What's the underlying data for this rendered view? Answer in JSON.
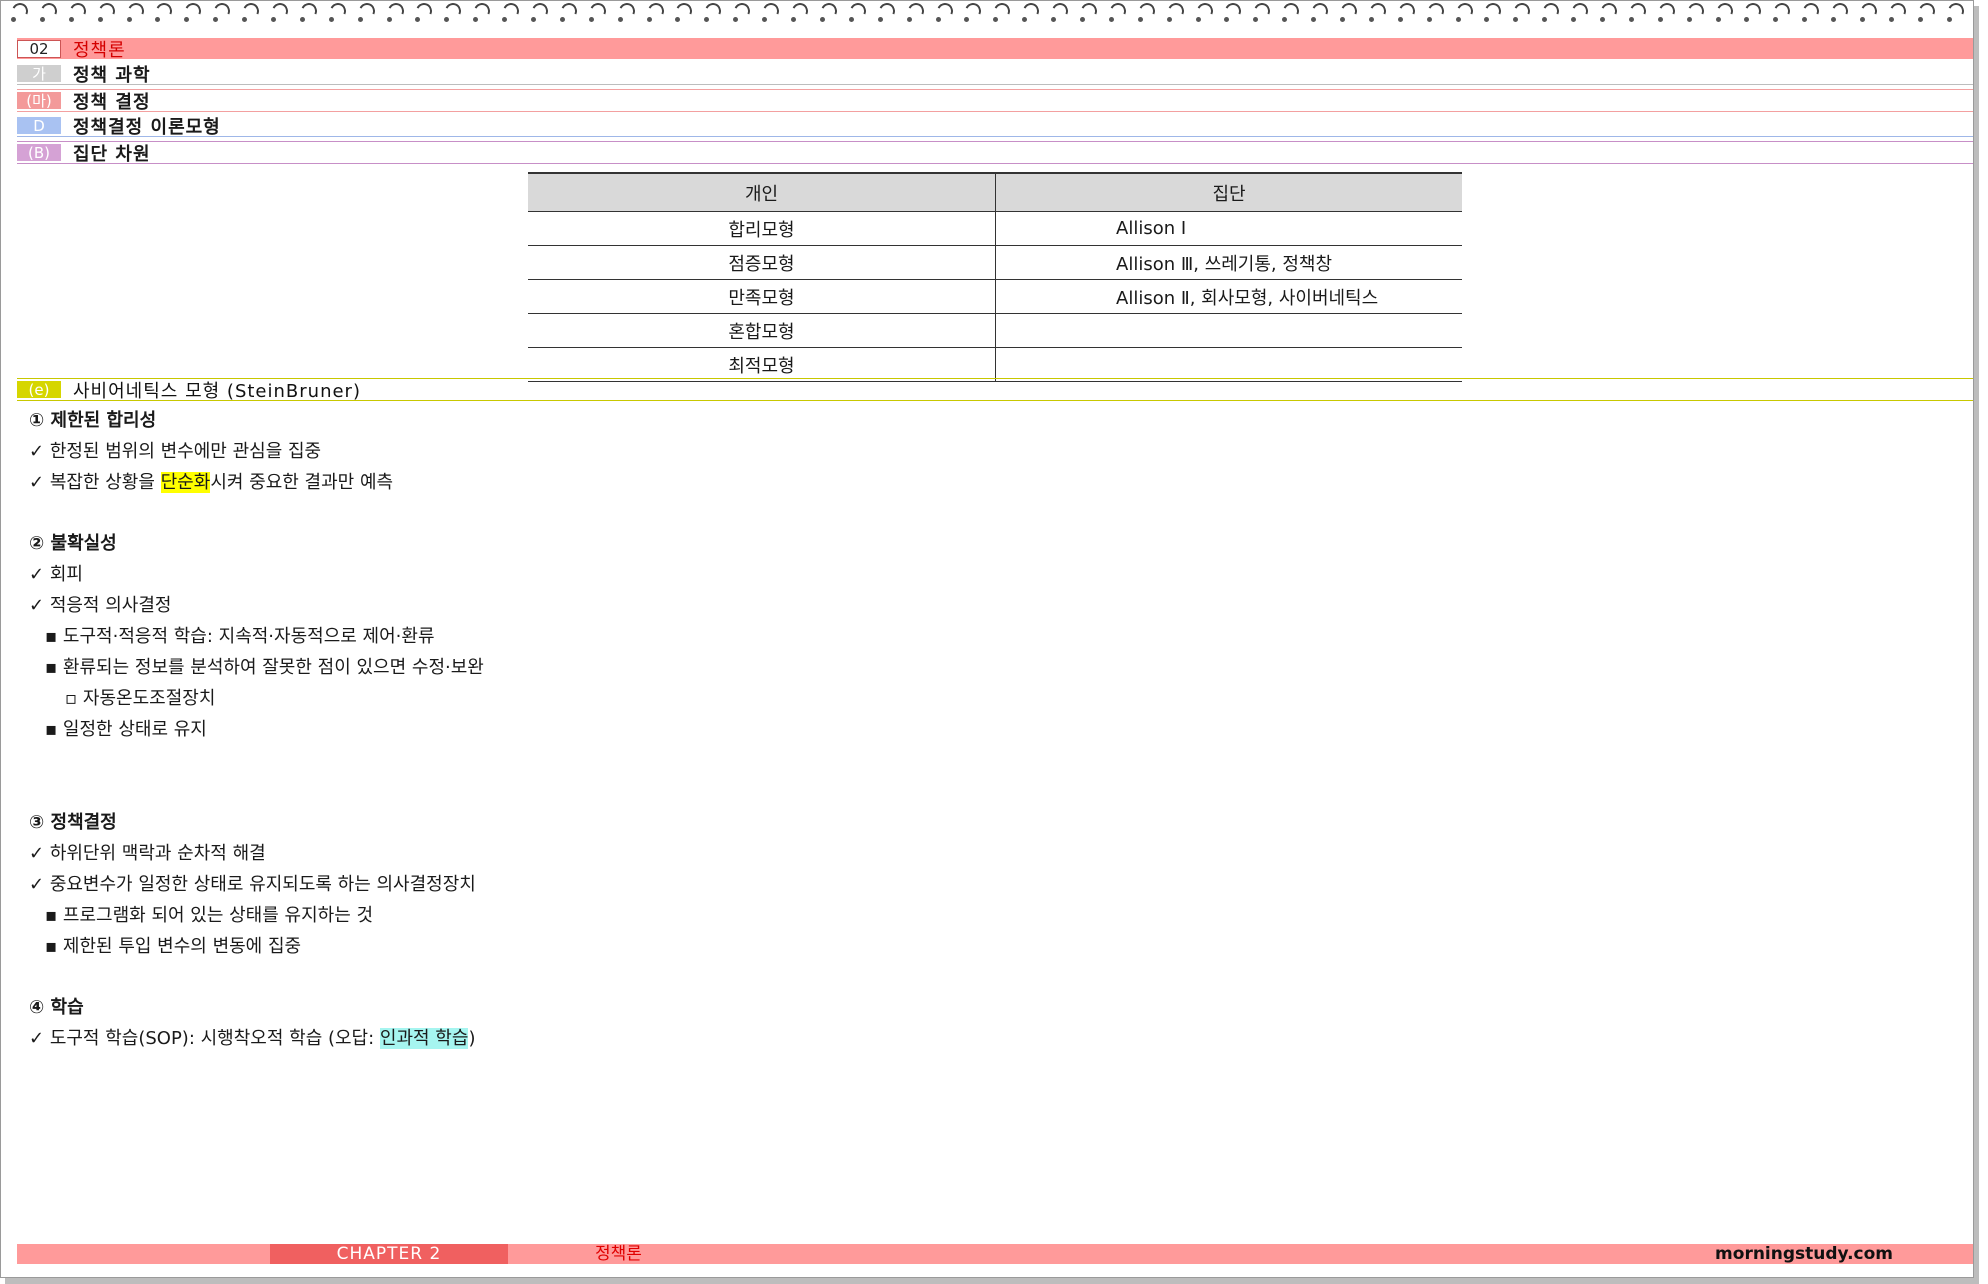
{
  "main_header": {
    "num": "02",
    "title": "정책론"
  },
  "sections": [
    {
      "tag": "가",
      "title": "정책 과학"
    },
    {
      "tag": "(마)",
      "title": "정책 결정"
    },
    {
      "tag": "D",
      "title": "정책결정 이론모형"
    },
    {
      "tag": "(B)",
      "title": "집단 차원"
    }
  ],
  "table": {
    "headers": [
      "개인",
      "집단"
    ],
    "rows": [
      [
        "합리모형",
        "Allison Ⅰ"
      ],
      [
        "점증모형",
        "Allison Ⅲ, 쓰레기통, 정책창"
      ],
      [
        "만족모형",
        "Allison Ⅱ, 회사모형, 사이버네틱스"
      ],
      [
        "혼합모형",
        ""
      ],
      [
        "최적모형",
        ""
      ]
    ]
  },
  "section_e": {
    "tag": "(e)",
    "title": "사비어네틱스 모형 (SteinBruner)"
  },
  "content": {
    "h1": "① 제한된 합리성",
    "c1": "한정된 범위의 변수에만 관심을 집중",
    "c2_pre": "복잡한 상황을 ",
    "c2_hl": "단순화",
    "c2_post": "시켜 중요한 결과만 예측",
    "h2": "② 불확실성",
    "c3": "회피",
    "c4": "적응적 의사결정",
    "s1": "도구적·적응적 학습: 지속적·자동적으로 제어·환류",
    "s2": "환류되는 정보를 분석하여 잘못한 점이 있으면 수정·보완",
    "s3": "자동온도조절장치",
    "s4": "일정한 상태로 유지",
    "h3": "③ 정책결정",
    "c5": "하위단위 맥락과 순차적 해결",
    "c6": "중요변수가 일정한 상태로 유지되도록 하는 의사결정장치",
    "s5": "프로그램화 되어 있는 상태를 유지하는 것",
    "s6": "제한된 투입 변수의 변동에 집중",
    "h4": "④ 학습",
    "c7_pre": "도구적 학습(SOP): 시행착오적 학습 (오답: ",
    "c7_hl": "인과적 학습",
    "c7_post": ")"
  },
  "footer": {
    "chapter": "CHAPTER 2",
    "title": "정책론",
    "site": "morningstudy.com"
  }
}
